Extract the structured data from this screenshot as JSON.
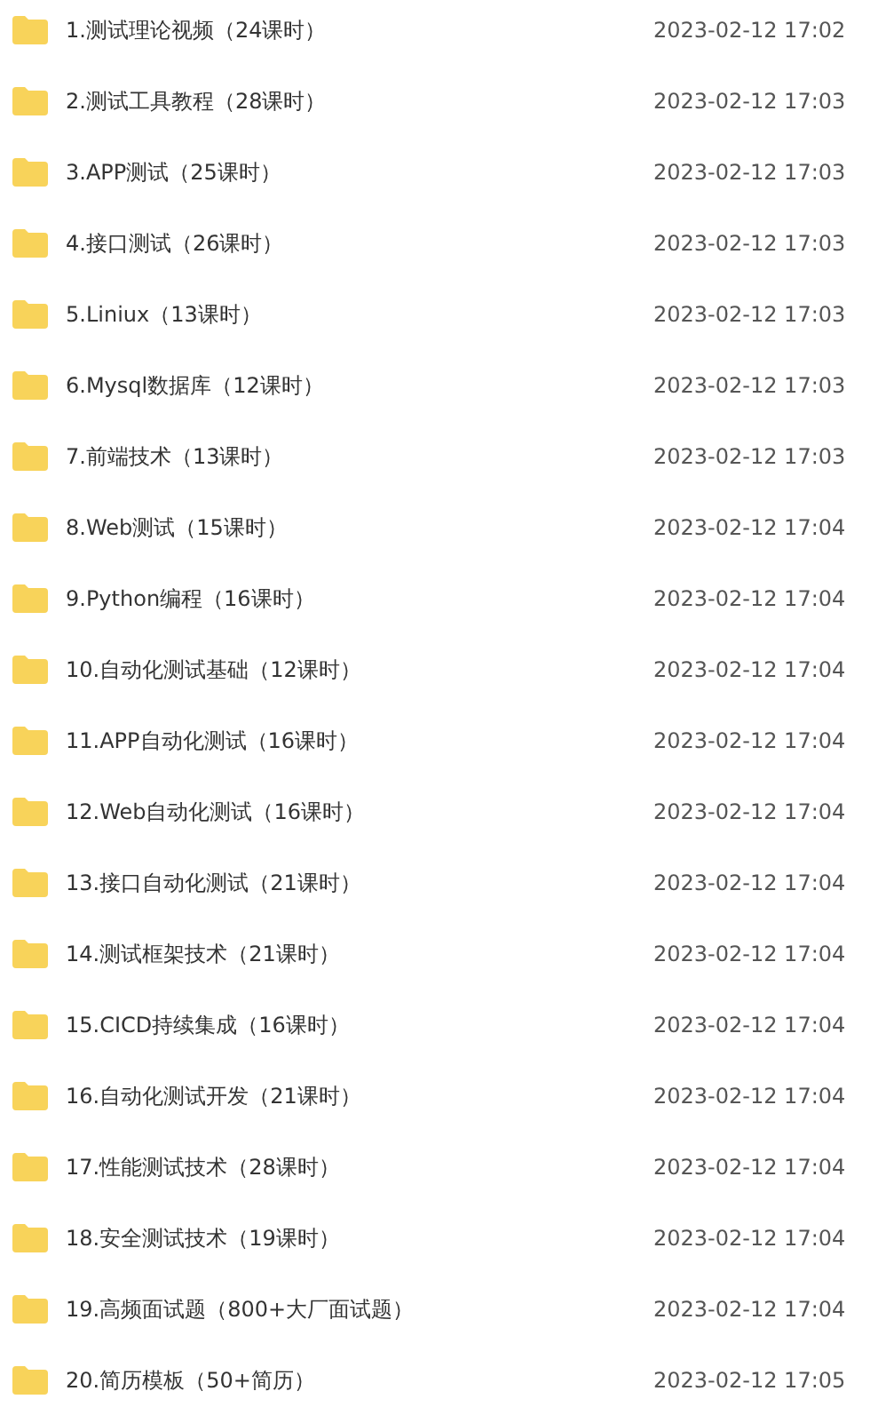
{
  "files": [
    {
      "name": "1.测试理论视频（24课时）",
      "modified": "2023-02-12 17:02"
    },
    {
      "name": "2.测试工具教程（28课时）",
      "modified": "2023-02-12 17:03"
    },
    {
      "name": "3.APP测试（25课时）",
      "modified": "2023-02-12 17:03"
    },
    {
      "name": "4.接口测试（26课时）",
      "modified": "2023-02-12 17:03"
    },
    {
      "name": "5.Liniux（13课时）",
      "modified": "2023-02-12 17:03"
    },
    {
      "name": "6.Mysql数据库（12课时）",
      "modified": "2023-02-12 17:03"
    },
    {
      "name": "7.前端技术（13课时）",
      "modified": "2023-02-12 17:03"
    },
    {
      "name": "8.Web测试（15课时）",
      "modified": "2023-02-12 17:04"
    },
    {
      "name": "9.Python编程（16课时）",
      "modified": "2023-02-12 17:04"
    },
    {
      "name": "10.自动化测试基础（12课时）",
      "modified": "2023-02-12 17:04"
    },
    {
      "name": "11.APP自动化测试（16课时）",
      "modified": "2023-02-12 17:04"
    },
    {
      "name": "12.Web自动化测试（16课时）",
      "modified": "2023-02-12 17:04"
    },
    {
      "name": "13.接口自动化测试（21课时）",
      "modified": "2023-02-12 17:04"
    },
    {
      "name": "14.测试框架技术（21课时）",
      "modified": "2023-02-12 17:04"
    },
    {
      "name": "15.CICD持续集成（16课时）",
      "modified": "2023-02-12 17:04"
    },
    {
      "name": "16.自动化测试开发（21课时）",
      "modified": "2023-02-12 17:04"
    },
    {
      "name": "17.性能测试技术（28课时）",
      "modified": "2023-02-12 17:04"
    },
    {
      "name": "18.安全测试技术（19课时）",
      "modified": "2023-02-12 17:04"
    },
    {
      "name": "19.高频面试题（800+大厂面试题）",
      "modified": "2023-02-12 17:04"
    },
    {
      "name": "20.简历模板（50+简历）",
      "modified": "2023-02-12 17:05"
    }
  ]
}
